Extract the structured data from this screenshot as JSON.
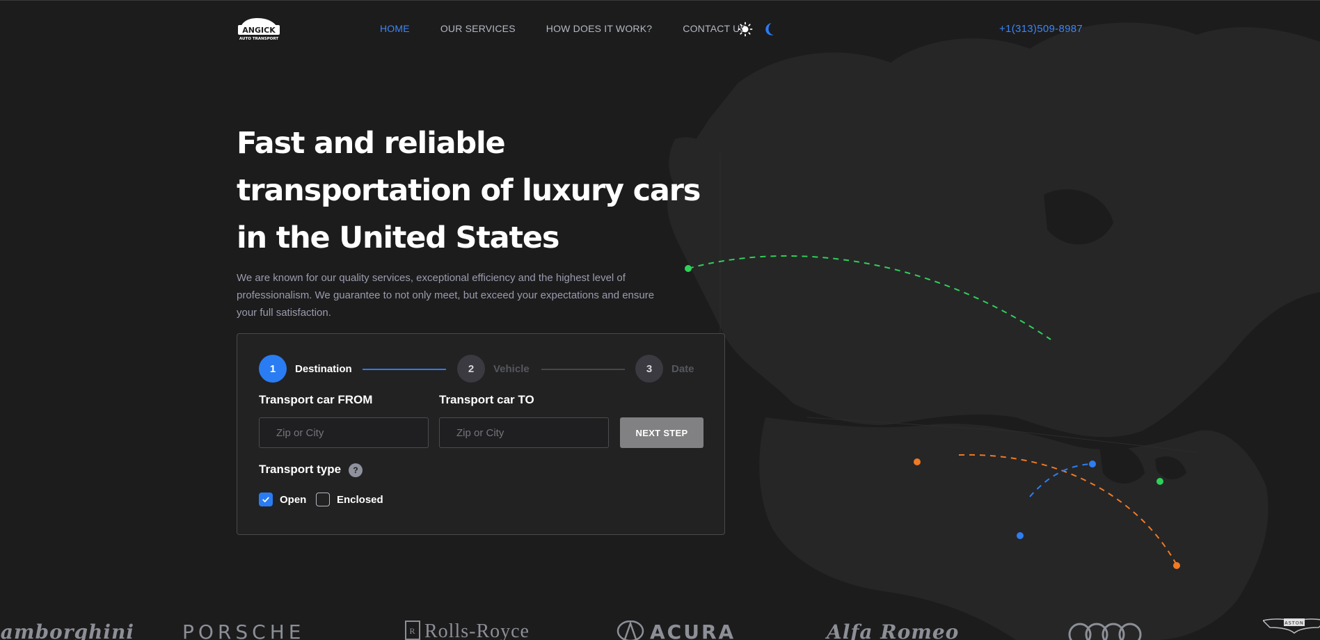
{
  "header": {
    "logo": {
      "text_top": "ANGICK",
      "text_bottom": "AUTO TRANSPORT"
    },
    "nav": [
      {
        "label": "HOME",
        "active": true
      },
      {
        "label": "OUR SERVICES",
        "active": false
      },
      {
        "label": "HOW DOES IT WORK?",
        "active": false
      },
      {
        "label": "CONTACT US",
        "active": false
      }
    ],
    "theme_toggle": {
      "light_icon": "sun-icon",
      "dark_icon": "moon-icon"
    },
    "phone": "+1(313)509-8987"
  },
  "hero": {
    "title": "Fast and reliable transportation of luxury cars in the United States",
    "description": "We are known for our quality services, exceptional efficiency and the highest level of professionalism. We guarantee to not only meet, but exceed your expectations and ensure your full satisfaction."
  },
  "booking": {
    "steps": [
      {
        "number": "1",
        "label": "Destination",
        "active": true
      },
      {
        "number": "2",
        "label": "Vehicle",
        "active": false
      },
      {
        "number": "3",
        "label": "Date",
        "active": false
      }
    ],
    "from": {
      "label": "Transport car FROM",
      "placeholder": "Zip or City",
      "value": ""
    },
    "to": {
      "label": "Transport car TO",
      "placeholder": "Zip or City",
      "value": ""
    },
    "next_button": "NEXT STEP",
    "transport_type": {
      "label": "Transport type",
      "help": "?",
      "options": [
        {
          "label": "Open",
          "checked": true
        },
        {
          "label": "Enclosed",
          "checked": false
        }
      ]
    }
  },
  "brands": [
    "Lamborghini",
    "PORSCHE",
    "Rolls-Royce",
    "ACURA",
    "Alfa Romeo",
    "Audi",
    "ASTON"
  ],
  "colors": {
    "background": "#1c1c1d",
    "accent": "#2a7cf3",
    "route_green": "#2ed158",
    "route_orange": "#f07a24",
    "route_blue": "#2f7ef0"
  }
}
